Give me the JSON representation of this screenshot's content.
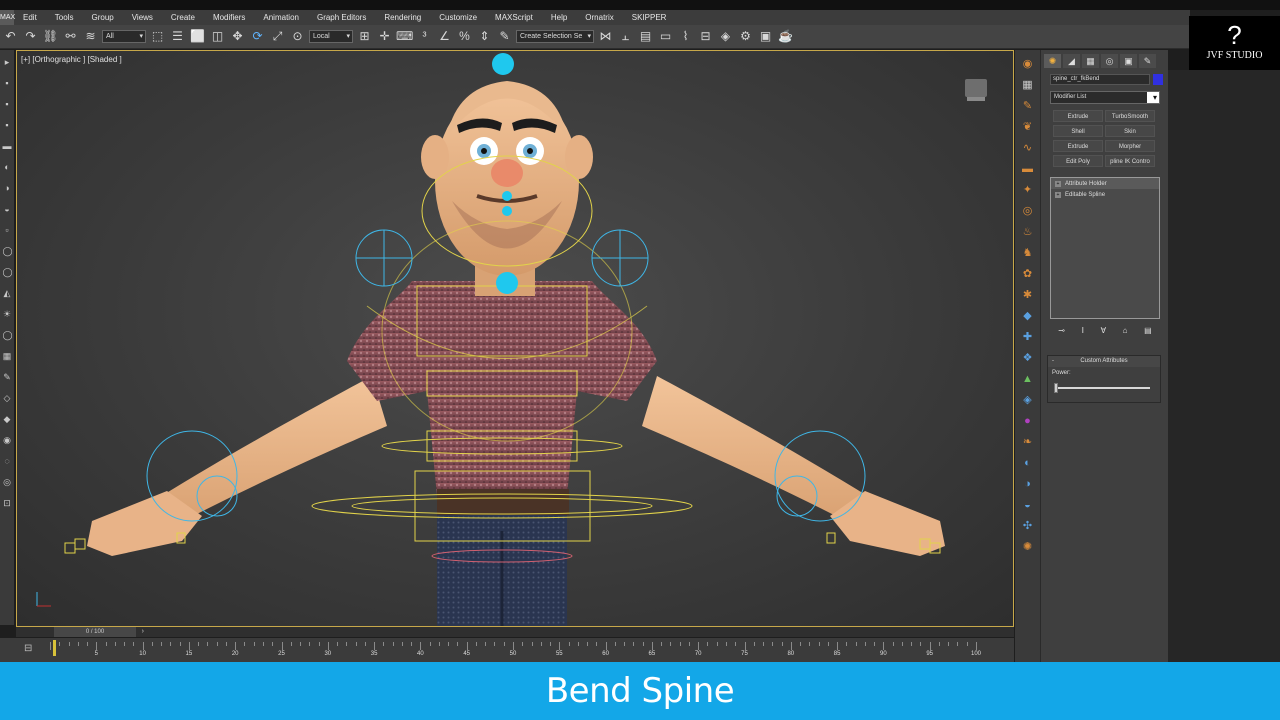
{
  "menu": {
    "items": [
      "Edit",
      "Tools",
      "Group",
      "Views",
      "Create",
      "Modifiers",
      "Animation",
      "Graph Editors",
      "Rendering",
      "Customize",
      "MAXScript",
      "Help",
      "Ornatrix",
      "SKIPPER"
    ]
  },
  "toolbar": {
    "selection_filter": "All",
    "reference_coord": "Local",
    "named_selection_placeholder": "Create Selection Se"
  },
  "viewport": {
    "label": "[+] [Orthographic ] [Shaded ]"
  },
  "command_panel": {
    "object_name": "spine_ctr_fkBend",
    "object_color": "#3030e0",
    "modifier_list": "Modifier List",
    "modifier_buttons": [
      "Extrude",
      "TurboSmooth",
      "Shell",
      "Skin",
      "Extrude",
      "Morpher",
      "Edit Poly",
      "pline IK Contro"
    ],
    "stack_items": [
      "Attribute Holder",
      "Editable Spline"
    ],
    "custom_attributes_title": "Custom Attributes",
    "power_label": "Power:",
    "power_value": 0.0
  },
  "timeline": {
    "frame_display": "0 / 100",
    "tick_labels": [
      "5",
      "10",
      "15",
      "20",
      "25",
      "30",
      "35",
      "40",
      "45",
      "50",
      "55",
      "60",
      "65",
      "70",
      "75",
      "80",
      "85",
      "90",
      "95",
      "100"
    ]
  },
  "studio_logo": "JVF STUDIO",
  "caption": "Bend Spine",
  "colors": {
    "caption_bg": "#13a7e8",
    "viewport_border": "#c7a84a",
    "rig_controls": "#e2d34a",
    "rig_ik_circles": "#3fb6e6"
  }
}
